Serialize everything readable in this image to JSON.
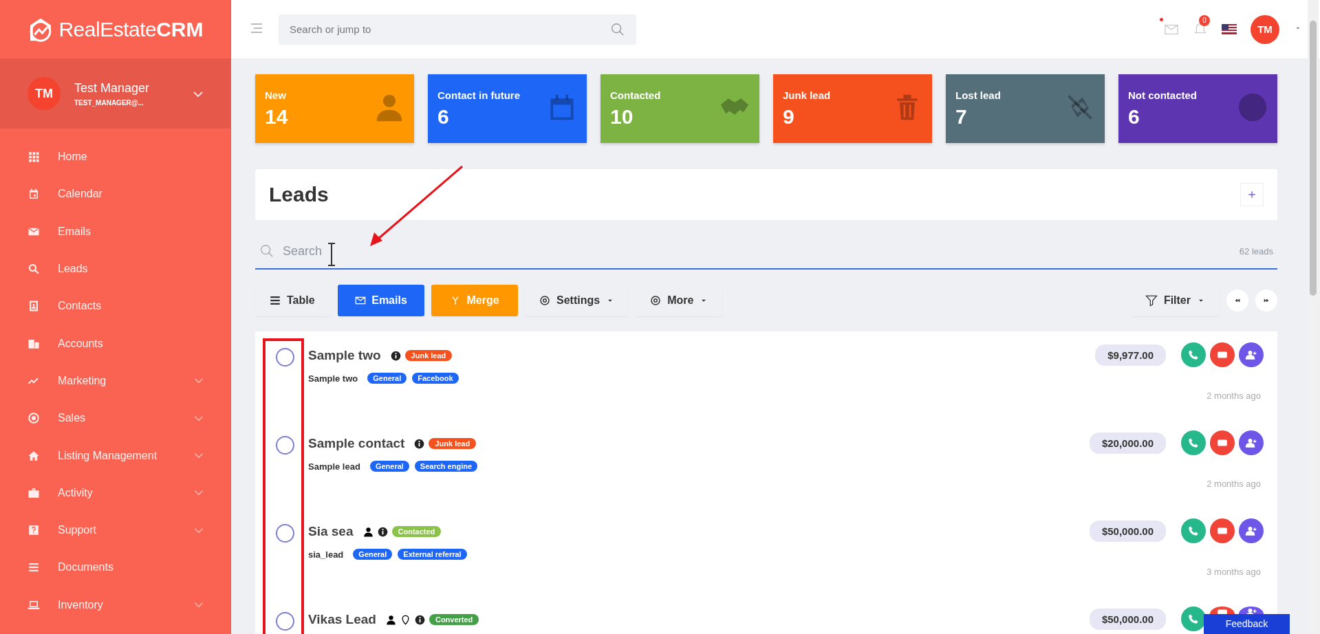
{
  "brand": {
    "name_light": "RealEstate",
    "name_bold": "CRM"
  },
  "user": {
    "initials": "TM",
    "name": "Test Manager",
    "email": "TEST_MANAGER@..."
  },
  "sidebar": {
    "items": [
      {
        "label": "Home",
        "expandable": false
      },
      {
        "label": "Calendar",
        "expandable": false
      },
      {
        "label": "Emails",
        "expandable": false
      },
      {
        "label": "Leads",
        "expandable": false
      },
      {
        "label": "Contacts",
        "expandable": false
      },
      {
        "label": "Accounts",
        "expandable": false
      },
      {
        "label": "Marketing",
        "expandable": true
      },
      {
        "label": "Sales",
        "expandable": true
      },
      {
        "label": "Listing Management",
        "expandable": true
      },
      {
        "label": "Activity",
        "expandable": true
      },
      {
        "label": "Support",
        "expandable": true
      },
      {
        "label": "Documents",
        "expandable": false
      },
      {
        "label": "Inventory",
        "expandable": true
      }
    ]
  },
  "topbar": {
    "search_placeholder": "Search or jump to",
    "notification_count": "0",
    "avatar_initials": "TM"
  },
  "stat_cards": [
    {
      "label": "New",
      "value": "14",
      "color": "#ff9800"
    },
    {
      "label": "Contact in future",
      "value": "6",
      "color": "#1e66f5"
    },
    {
      "label": "Contacted",
      "value": "10",
      "color": "#7cb342"
    },
    {
      "label": "Junk lead",
      "value": "9",
      "color": "#f4511e"
    },
    {
      "label": "Lost lead",
      "value": "7",
      "color": "#546e7a"
    },
    {
      "label": "Not contacted",
      "value": "6",
      "color": "#5e35b1"
    }
  ],
  "leads": {
    "title": "Leads",
    "search_placeholder": "Search",
    "count": "62 leads",
    "toolbar": [
      {
        "label": "Table",
        "kind": "plain"
      },
      {
        "label": "Emails",
        "kind": "blue"
      },
      {
        "label": "Merge",
        "kind": "orange"
      },
      {
        "label": "Settings",
        "kind": "dropdown"
      },
      {
        "label": "More",
        "kind": "dropdown"
      }
    ],
    "filter": "Filter",
    "rows": [
      {
        "name": "Sample two",
        "selected": false,
        "owner": false,
        "location": false,
        "status": {
          "label": "Junk lead",
          "color": "#f4511e"
        },
        "contact": "Sample two",
        "tags": [
          "General",
          "Facebook"
        ],
        "amount": "$9,977.00",
        "time": "2 months ago"
      },
      {
        "name": "Sample contact",
        "selected": false,
        "owner": false,
        "location": false,
        "status": {
          "label": "Junk lead",
          "color": "#f4511e"
        },
        "contact": "Sample lead",
        "tags": [
          "General",
          "Search engine"
        ],
        "amount": "$20,000.00",
        "time": "2 months ago"
      },
      {
        "name": "Sia sea",
        "selected": false,
        "owner": true,
        "location": false,
        "status": {
          "label": "Contacted",
          "color": "#8bc34a"
        },
        "contact": "sia_lead",
        "tags": [
          "General",
          "External referral"
        ],
        "amount": "$50,000.00",
        "time": "3 months ago"
      },
      {
        "name": "Vikas Lead",
        "selected": false,
        "owner": true,
        "location": true,
        "status": {
          "label": "Converted",
          "color": "#43a047"
        },
        "amount": "$50,000.00"
      }
    ]
  },
  "feedback": "Feedback"
}
